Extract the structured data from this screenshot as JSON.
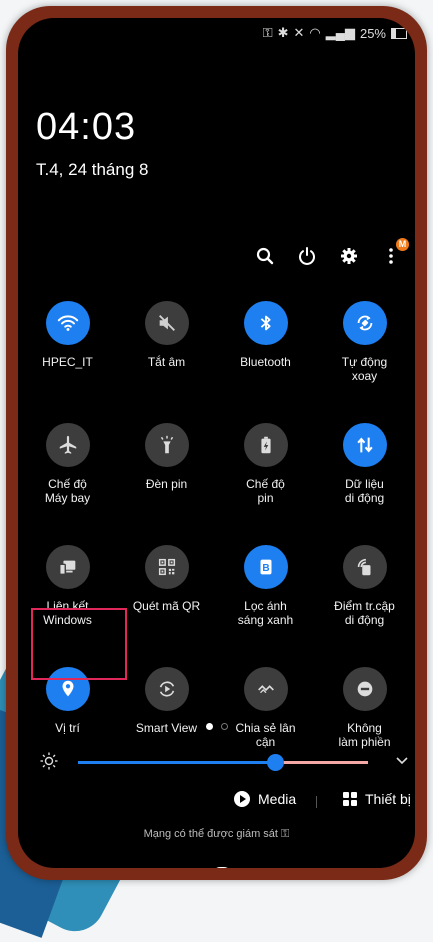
{
  "status_bar": {
    "battery_text": "25%"
  },
  "lockscreen": {
    "time": "04:03",
    "date": "T.4, 24 tháng 8"
  },
  "header": {
    "notification_badge": "M"
  },
  "tiles": [
    {
      "label": "HPEC_IT",
      "icon": "wifi-icon",
      "on": true
    },
    {
      "label": "Tắt âm",
      "icon": "mute-icon",
      "on": false
    },
    {
      "label": "Bluetooth",
      "icon": "bluetooth-icon",
      "on": true
    },
    {
      "label": "Tự động\nxoay",
      "icon": "auto-rotate-icon",
      "on": true
    },
    {
      "label": "Chế độ\nMáy bay",
      "icon": "airplane-icon",
      "on": false
    },
    {
      "label": "Đèn pin",
      "icon": "flashlight-icon",
      "on": false
    },
    {
      "label": "Chế độ\npin",
      "icon": "battery-saver-icon",
      "on": false
    },
    {
      "label": "Dữ liệu\ndi động",
      "icon": "mobile-data-icon",
      "on": true
    },
    {
      "label": "Liên kết\nWindows",
      "icon": "link-windows-icon",
      "on": false
    },
    {
      "label": "Quét mã QR",
      "icon": "qr-icon",
      "on": false
    },
    {
      "label": "Lọc ánh\nsáng xanh",
      "icon": "blue-light-icon",
      "on": true
    },
    {
      "label": "Điểm tr.cập\ndi động",
      "icon": "hotspot-icon",
      "on": false
    },
    {
      "label": "Vị trí",
      "icon": "location-icon",
      "on": true
    },
    {
      "label": "Smart View",
      "icon": "smart-view-icon",
      "on": false
    },
    {
      "label": "Chia sẻ lân\ncận",
      "icon": "nearby-share-icon",
      "on": false
    },
    {
      "label": "Không\nlàm phiền",
      "icon": "do-not-disturb-icon",
      "on": false
    }
  ],
  "brightness": {
    "level": 0.68
  },
  "media": {
    "media_label": "Media",
    "devices_label": "Thiết bị"
  },
  "footer": {
    "monitor_text": "Mạng có thể được giám sát"
  },
  "colors": {
    "accent": "#1e7ff0",
    "tile_off": "#3d3d3d",
    "highlight": "#e0285a"
  }
}
